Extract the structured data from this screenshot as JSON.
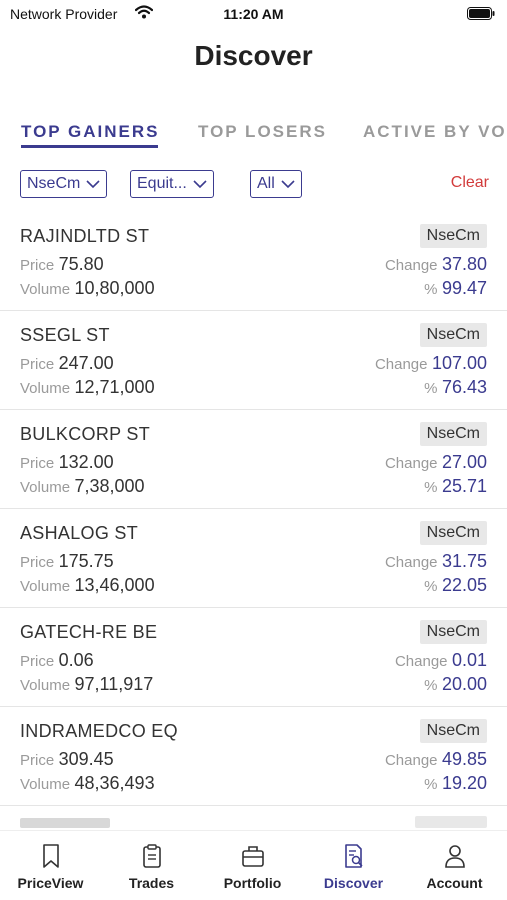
{
  "status_bar": {
    "carrier": "Network Provider",
    "time": "11:20 AM"
  },
  "title": "Discover",
  "tabs": [
    {
      "label": "TOP GAINERS",
      "active": true
    },
    {
      "label": "TOP LOSERS",
      "active": false
    },
    {
      "label": "ACTIVE BY VO",
      "active": false
    }
  ],
  "filters": {
    "exchange": "NseCm",
    "segment": "Equit...",
    "group": "All",
    "clear_label": "Clear"
  },
  "labels": {
    "price": "Price",
    "volume": "Volume",
    "change": "Change",
    "percent": "%"
  },
  "rows": [
    {
      "symbol": "RAJINDLTD ST",
      "exchange": "NseCm",
      "price": "75.80",
      "volume": "10,80,000",
      "change": "37.80",
      "percent": "99.47"
    },
    {
      "symbol": "SSEGL ST",
      "exchange": "NseCm",
      "price": "247.00",
      "volume": "12,71,000",
      "change": "107.00",
      "percent": "76.43"
    },
    {
      "symbol": "BULKCORP ST",
      "exchange": "NseCm",
      "price": "132.00",
      "volume": "7,38,000",
      "change": "27.00",
      "percent": "25.71"
    },
    {
      "symbol": "ASHALOG ST",
      "exchange": "NseCm",
      "price": "175.75",
      "volume": "13,46,000",
      "change": "31.75",
      "percent": "22.05"
    },
    {
      "symbol": "GATECH-RE BE",
      "exchange": "NseCm",
      "price": "0.06",
      "volume": "97,11,917",
      "change": "0.01",
      "percent": "20.00"
    },
    {
      "symbol": "INDRAMEDCO EQ",
      "exchange": "NseCm",
      "price": "309.45",
      "volume": "48,36,493",
      "change": "49.85",
      "percent": "19.20"
    }
  ],
  "nav": [
    {
      "label": "PriceView",
      "icon": "bookmark-icon",
      "active": false
    },
    {
      "label": "Trades",
      "icon": "clipboard-icon",
      "active": false
    },
    {
      "label": "Portfolio",
      "icon": "briefcase-icon",
      "active": false
    },
    {
      "label": "Discover",
      "icon": "discover-icon",
      "active": true
    },
    {
      "label": "Account",
      "icon": "user-icon",
      "active": false
    }
  ],
  "colors": {
    "accent": "#3b3b8f",
    "clear": "#d23b3b",
    "badge_bg": "#e8e8e8"
  }
}
